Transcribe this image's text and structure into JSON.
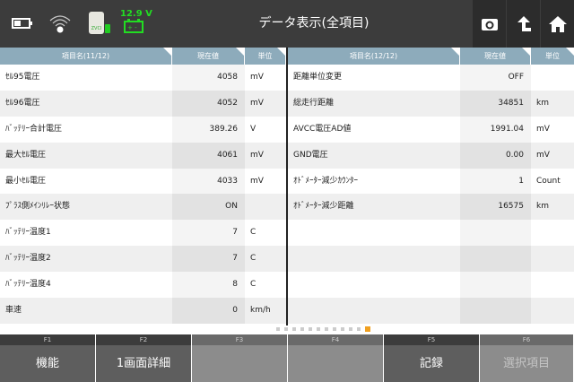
{
  "header": {
    "title": "データ表示(全項目)",
    "battery_voltage": "12.9 V",
    "zvci_label": "ZVCI",
    "icons": [
      "battery-icon",
      "wifi-icon",
      "zvci-icon",
      "car-battery-icon",
      "camera-icon",
      "upload-icon",
      "home-icon"
    ]
  },
  "left": {
    "headers": {
      "name": "項目名(11/12)",
      "value": "現在値",
      "unit": "単位"
    },
    "rows": [
      {
        "name": "ｾﾙ95電圧",
        "value": "4058",
        "unit": "mV"
      },
      {
        "name": "ｾﾙ96電圧",
        "value": "4052",
        "unit": "mV"
      },
      {
        "name": "ﾊﾞｯﾃﾘｰ合計電圧",
        "value": "389.26",
        "unit": "V"
      },
      {
        "name": "最大ｾﾙ電圧",
        "value": "4061",
        "unit": "mV"
      },
      {
        "name": "最小ｾﾙ電圧",
        "value": "4033",
        "unit": "mV"
      },
      {
        "name": "ﾌﾟﾗｽ側ﾒｲﾝﾘﾚｰ状態",
        "value": "ON",
        "unit": ""
      },
      {
        "name": "ﾊﾞｯﾃﾘｰ温度1",
        "value": "7",
        "unit": "C"
      },
      {
        "name": "ﾊﾞｯﾃﾘｰ温度2",
        "value": "7",
        "unit": "C"
      },
      {
        "name": "ﾊﾞｯﾃﾘｰ温度4",
        "value": "8",
        "unit": "C"
      },
      {
        "name": "車速",
        "value": "0",
        "unit": "km/h"
      }
    ]
  },
  "right": {
    "headers": {
      "name": "項目名(12/12)",
      "value": "現在値",
      "unit": "単位"
    },
    "rows": [
      {
        "name": "距離単位変更",
        "value": "OFF",
        "unit": ""
      },
      {
        "name": "総走行距離",
        "value": "34851",
        "unit": "km"
      },
      {
        "name": "AVCC電圧AD値",
        "value": "1991.04",
        "unit": "mV"
      },
      {
        "name": "GND電圧",
        "value": "0.00",
        "unit": "mV"
      },
      {
        "name": "ｵﾄﾞﾒｰﾀｰ減少ｶｳﾝﾀｰ",
        "value": "1",
        "unit": "Count"
      },
      {
        "name": "ｵﾄﾞﾒｰﾀｰ減少距離",
        "value": "16575",
        "unit": "km"
      },
      {
        "name": "",
        "value": "",
        "unit": ""
      },
      {
        "name": "",
        "value": "",
        "unit": ""
      },
      {
        "name": "",
        "value": "",
        "unit": ""
      },
      {
        "name": "",
        "value": "",
        "unit": ""
      }
    ]
  },
  "pager": {
    "total": 12,
    "current": 12
  },
  "fkeys": [
    {
      "key": "F1",
      "label": "機能",
      "enabled": true
    },
    {
      "key": "F2",
      "label": "1画面詳細",
      "enabled": true
    },
    {
      "key": "F3",
      "label": "",
      "enabled": false
    },
    {
      "key": "F4",
      "label": "",
      "enabled": false
    },
    {
      "key": "F5",
      "label": "記録",
      "enabled": true
    },
    {
      "key": "F6",
      "label": "選択項目",
      "enabled": false
    }
  ]
}
